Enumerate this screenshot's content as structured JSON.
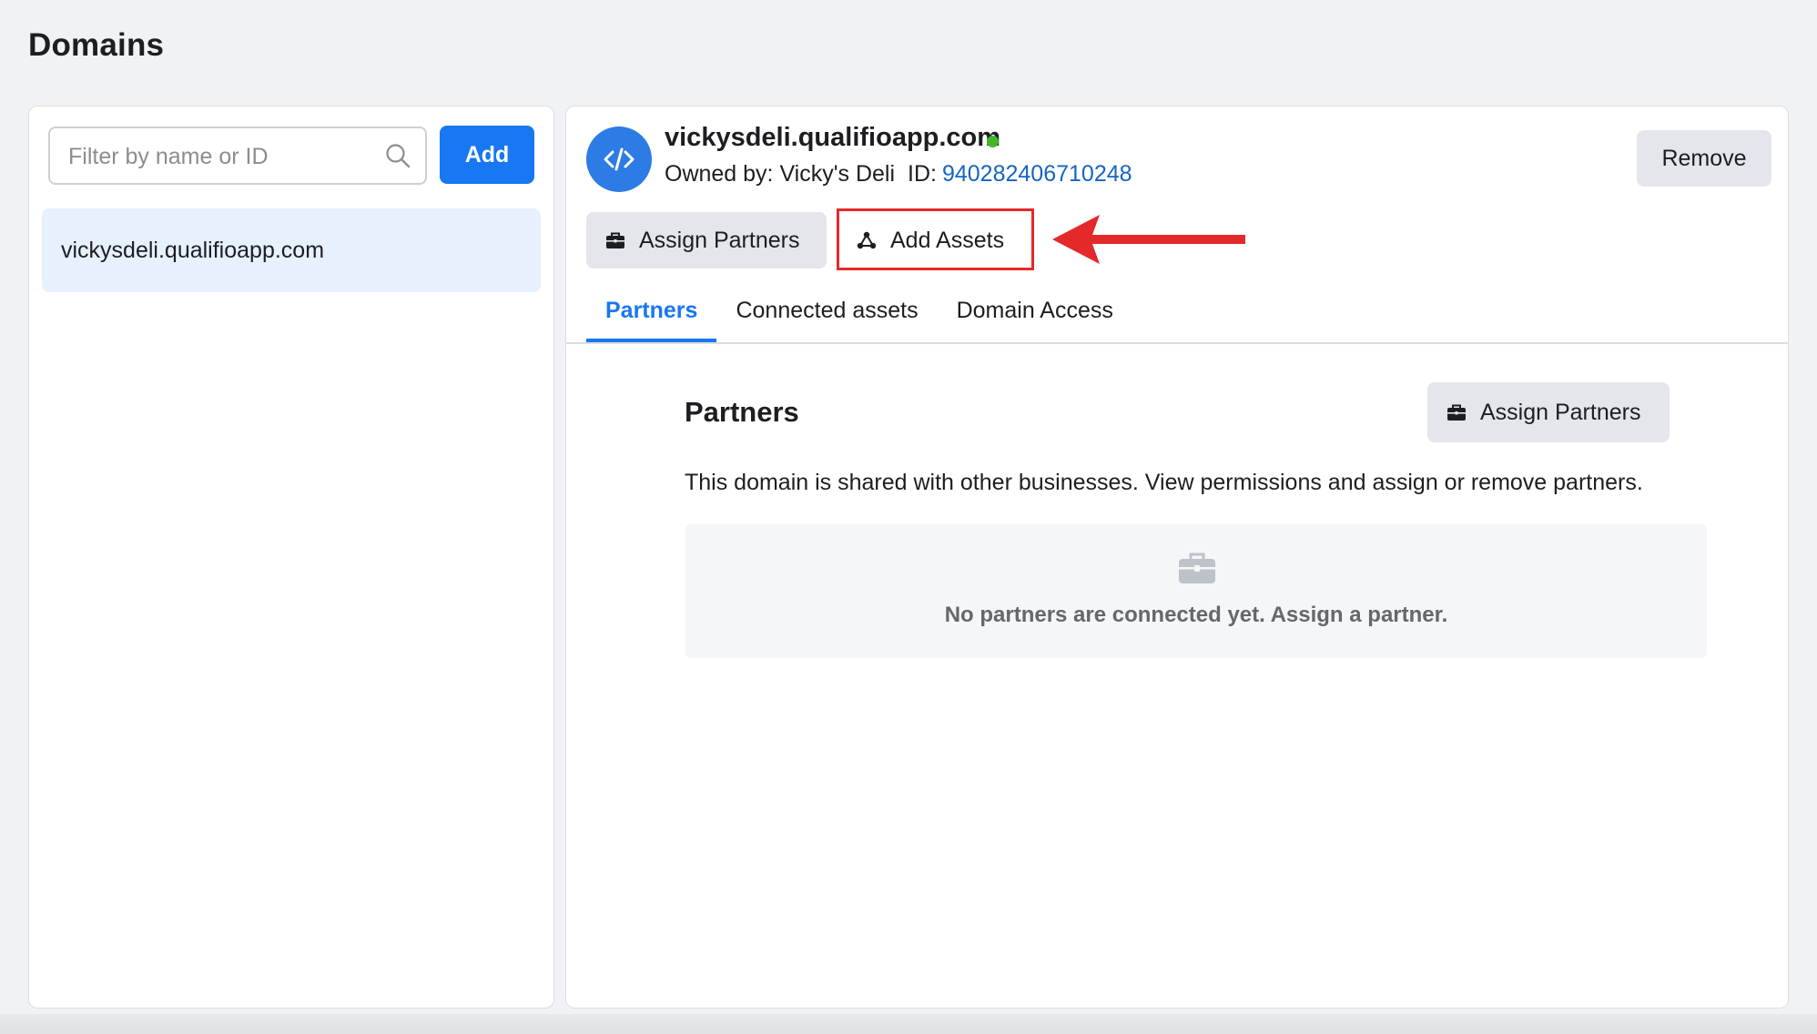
{
  "page": {
    "title": "Domains"
  },
  "sidebar": {
    "search": {
      "placeholder": "Filter by name or ID",
      "value": "",
      "icon": "search-icon"
    },
    "add_label": "Add",
    "items": [
      {
        "label": "vickysdeli.qualifioapp.com",
        "selected": true
      }
    ]
  },
  "detail": {
    "domain_name": "vickysdeli.qualifioapp.com",
    "status": "active",
    "owner_label": "Owned by: Vicky's Deli",
    "id_label": "ID:",
    "id_value": "940282406710248",
    "remove_label": "Remove",
    "actions": {
      "assign_partners_label": "Assign Partners",
      "add_assets_label": "Add Assets"
    },
    "tabs": [
      {
        "label": "Partners",
        "active": true
      },
      {
        "label": "Connected assets",
        "active": false
      },
      {
        "label": "Domain Access",
        "active": false
      }
    ],
    "section": {
      "title": "Partners",
      "assign_label": "Assign Partners",
      "description": "This domain is shared with other businesses. View permissions and assign or remove partners.",
      "empty_message": "No partners are connected yet. Assign a partner."
    }
  },
  "colors": {
    "accent": "#1877f2",
    "status_active": "#42b72a",
    "id_link": "#1565c0",
    "annotation": "#e4292a",
    "selected_item_bg": "#e7f0fd"
  },
  "icons": {
    "domain_avatar": "code-icon",
    "assign_partners": "briefcase-icon",
    "add_assets": "nodes-icon",
    "empty_state": "briefcase-icon",
    "annotation": "arrow-left-icon"
  }
}
